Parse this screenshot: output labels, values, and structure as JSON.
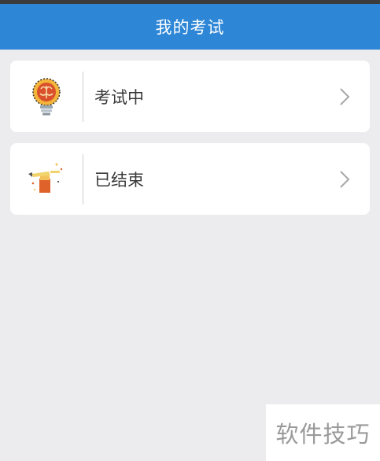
{
  "header": {
    "title": "我的考试"
  },
  "items": [
    {
      "label": "考试中",
      "icon": "lightbulb-brain-icon"
    },
    {
      "label": "已结束",
      "icon": "pencil-sparkle-icon"
    }
  ],
  "icons": {
    "chevron": "chevron-right-icon"
  },
  "colors": {
    "header_bg": "#2d86d6",
    "page_bg": "#ececee",
    "card_bg": "#ffffff",
    "text": "#3a3a3a"
  },
  "watermark": {
    "text": "软件技巧"
  }
}
